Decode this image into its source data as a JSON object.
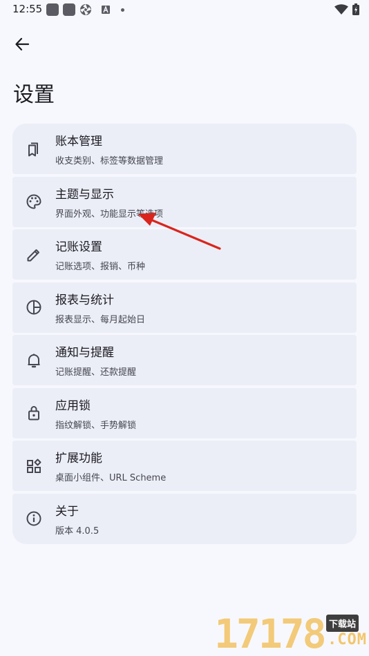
{
  "status_bar": {
    "time": "12:55"
  },
  "header": {
    "title": "设置"
  },
  "items": [
    {
      "title": "账本管理",
      "subtitle": "收支类别、标签等数据管理",
      "icon": "book-icon"
    },
    {
      "title": "主题与显示",
      "subtitle": "界面外观、功能显示等选项",
      "icon": "palette-icon"
    },
    {
      "title": "记账设置",
      "subtitle": "记账选项、报销、币种",
      "icon": "pencil-icon"
    },
    {
      "title": "报表与统计",
      "subtitle": "报表显示、每月起始日",
      "icon": "pie-chart-icon"
    },
    {
      "title": "通知与提醒",
      "subtitle": "记账提醒、还款提醒",
      "icon": "bell-icon"
    },
    {
      "title": "应用锁",
      "subtitle": "指纹解锁、手势解锁",
      "icon": "lock-icon"
    },
    {
      "title": "扩展功能",
      "subtitle": "桌面小组件、URL Scheme",
      "icon": "widgets-icon"
    },
    {
      "title": "关于",
      "subtitle": "版本 4.0.5",
      "icon": "info-icon"
    }
  ],
  "watermark": {
    "number": "17178",
    "badge": "下载站",
    "suffix": ".COM"
  },
  "colors": {
    "background": "#f7f8fe",
    "card": "#eceef7",
    "annotation": "#d9251d"
  }
}
